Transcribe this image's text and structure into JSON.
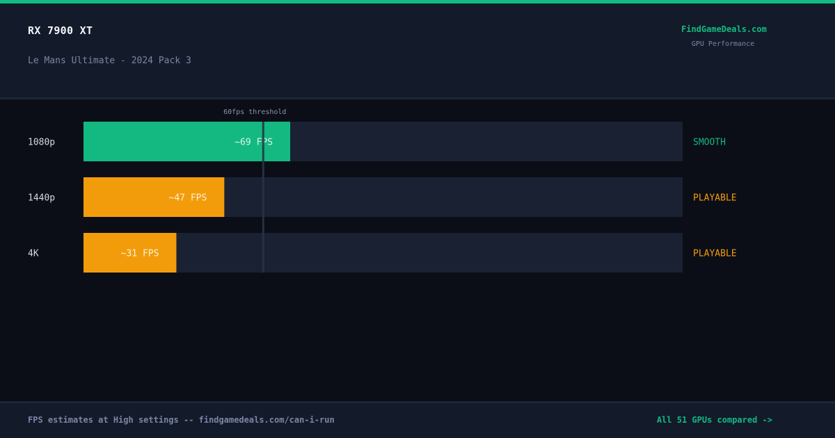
{
  "header": {
    "gpu_name": "RX 7900 XT",
    "game_title": "Le Mans Ultimate - 2024 Pack 3",
    "brand": "FindGameDeals.com",
    "brand_sub": "GPU Performance"
  },
  "colors": {
    "smooth": "#13b981",
    "playable": "#f39c0b",
    "track": "#1a2133",
    "threshold_line": "#2a3346",
    "accent": "#13b981"
  },
  "chart_data": {
    "type": "bar",
    "orientation": "horizontal",
    "categories": [
      "1080p",
      "1440p",
      "4K"
    ],
    "values": [
      69,
      47,
      31
    ],
    "value_labels": [
      "~69 FPS",
      "~47 FPS",
      "~31 FPS"
    ],
    "ratings": [
      "SMOOTH",
      "PLAYABLE",
      "PLAYABLE"
    ],
    "xlim": [
      0,
      200
    ],
    "threshold": {
      "value": 60,
      "label": "60fps threshold"
    },
    "grid": false
  },
  "footer": {
    "note": "FPS estimates at High settings -- findgamedeals.com/can-i-run",
    "link": "All 51 GPUs compared ->"
  }
}
